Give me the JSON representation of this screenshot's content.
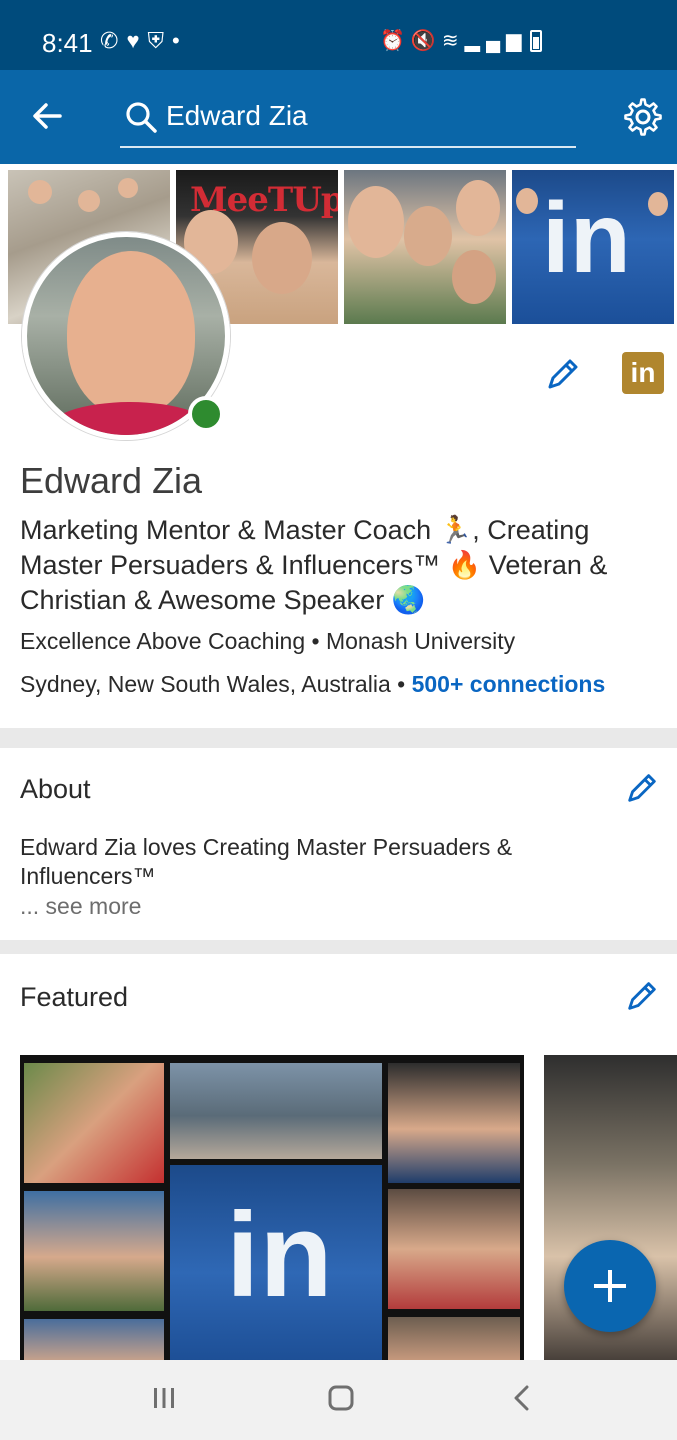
{
  "status_bar": {
    "time": "8:41",
    "left_icons": [
      "whatsapp-icon",
      "heart-icon",
      "shield-icon",
      "dot-icon"
    ],
    "right_icons": [
      "alarm-icon",
      "mute-icon",
      "wifi-icon",
      "volte-icon",
      "signal-icon",
      "battery-icon"
    ]
  },
  "search": {
    "query": "Edward Zia",
    "icons": {
      "back": "back-arrow-icon",
      "search": "search-icon",
      "settings": "gear-icon"
    }
  },
  "profile": {
    "name": "Edward Zia",
    "headline": "Marketing Mentor & Master Coach 🏃, Creating Master Persuaders & Influencers™ 🔥 Veteran & Christian & Awesome Speaker 🌏",
    "company": "Excellence Above Coaching",
    "school": "Monash University",
    "separator": "•",
    "location": "Sydney, New South Wales, Australia",
    "connections": "500+ connections",
    "online_color": "#2e8b2f",
    "badge_text": "in"
  },
  "banner": {
    "sign_text": "MeeTUp",
    "in_text": "in"
  },
  "about": {
    "title": "About",
    "text": "Edward Zia loves Creating Master Persuaders & Influencers™",
    "see_more": "... see more"
  },
  "featured": {
    "title": "Featured"
  },
  "colors": {
    "status_bar": "#004b7c",
    "top_bar": "#0a66a8",
    "link": "#0a66c2",
    "fab": "#0a66b0",
    "linkedin_badge": "#b0862e"
  },
  "nav": [
    "recent-apps-icon",
    "home-icon",
    "back-icon"
  ]
}
